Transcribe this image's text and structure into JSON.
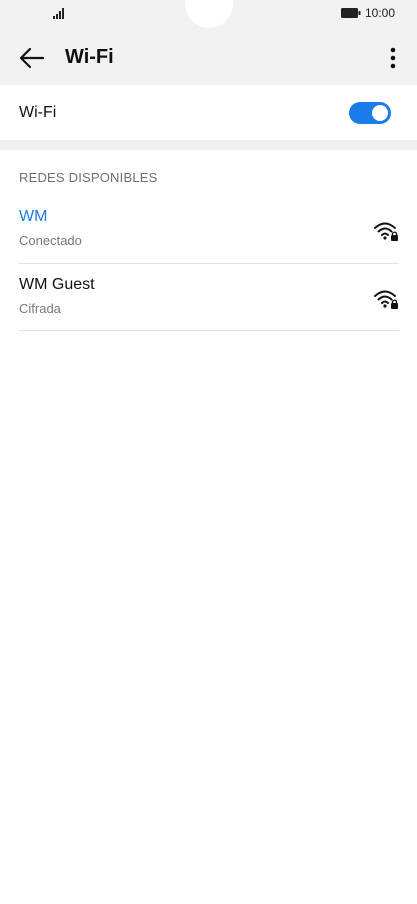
{
  "status_bar": {
    "time": "10:00",
    "signal_icon": "signal-icon",
    "battery_icon": "battery-icon"
  },
  "header": {
    "title": "Wi-Fi",
    "back_icon": "arrow-left-icon",
    "more_icon": "more-vert-icon"
  },
  "wifi_toggle": {
    "label": "Wi-Fi",
    "state": "on",
    "accent_color": "#1a7ce8"
  },
  "networks_section": {
    "title": "REDES DISPONIBLES",
    "networks": [
      {
        "name": "WM",
        "status": "Conectado",
        "connected": true,
        "icon": "wifi-lock-icon"
      },
      {
        "name": "WM Guest",
        "status": "Cifrada",
        "connected": false,
        "icon": "wifi-lock-icon"
      }
    ]
  }
}
